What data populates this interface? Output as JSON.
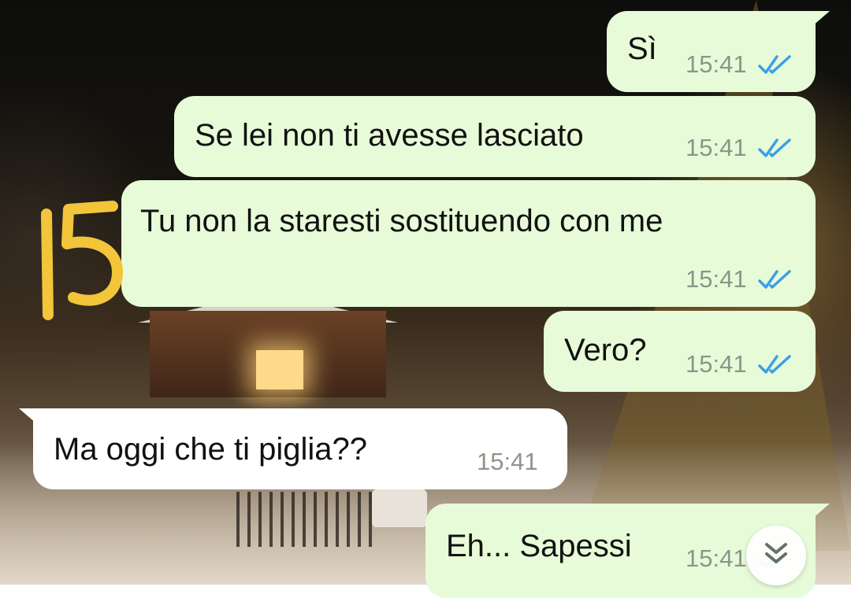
{
  "messages": [
    {
      "direction": "outgoing",
      "text": "Sì",
      "time": "15:41",
      "status": "read"
    },
    {
      "direction": "outgoing",
      "text": "Se lei non ti avesse lasciato",
      "time": "15:41",
      "status": "read"
    },
    {
      "direction": "outgoing",
      "text": "Tu non la staresti sostituendo con me",
      "time": "15:41",
      "status": "read"
    },
    {
      "direction": "outgoing",
      "text": "Vero?",
      "time": "15:41",
      "status": "read"
    },
    {
      "direction": "incoming",
      "text": "Ma oggi che ti piglia??",
      "time": "15:41"
    },
    {
      "direction": "outgoing",
      "text": "Eh... Sapessi",
      "time": "15:41",
      "status": "read"
    }
  ],
  "annotation": {
    "text": "15",
    "color": "#f2c53a"
  },
  "icons": {
    "read_receipt": "double-check-icon",
    "scroll_down": "chevron-double-down-icon"
  },
  "colors": {
    "outgoing_bubble": "#e7fbd8",
    "incoming_bubble": "#ffffff",
    "read_tick": "#3aa0e6",
    "timestamp": "#8b9688"
  }
}
